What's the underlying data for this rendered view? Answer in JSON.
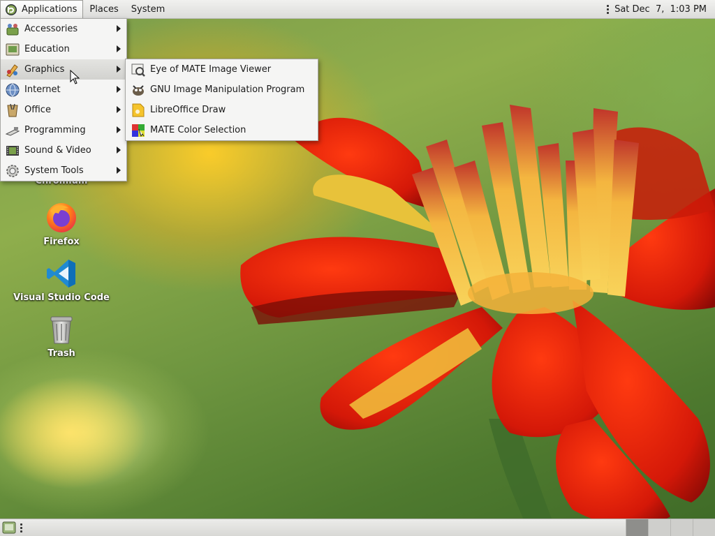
{
  "top_panel": {
    "applications_label": "Applications",
    "places_label": "Places",
    "system_label": "System",
    "clock": "Sat Dec  7,  1:03 PM"
  },
  "applications_menu": {
    "items": [
      {
        "label": "Accessories",
        "icon": "accessories-icon"
      },
      {
        "label": "Education",
        "icon": "education-icon"
      },
      {
        "label": "Graphics",
        "icon": "graphics-icon",
        "highlighted": true
      },
      {
        "label": "Internet",
        "icon": "internet-icon"
      },
      {
        "label": "Office",
        "icon": "office-icon"
      },
      {
        "label": "Programming",
        "icon": "programming-icon"
      },
      {
        "label": "Sound & Video",
        "icon": "sound-video-icon"
      },
      {
        "label": "System Tools",
        "icon": "system-tools-icon"
      }
    ]
  },
  "graphics_submenu": {
    "items": [
      {
        "label": "Eye of MATE Image Viewer",
        "icon": "image-viewer-icon"
      },
      {
        "label": "GNU Image Manipulation Program",
        "icon": "gimp-icon"
      },
      {
        "label": "LibreOffice Draw",
        "icon": "libreoffice-draw-icon"
      },
      {
        "label": "MATE Color Selection",
        "icon": "color-selection-icon"
      }
    ]
  },
  "desktop": {
    "icons": [
      {
        "label": "Chromium",
        "icon": "chromium-icon"
      },
      {
        "label": "Firefox",
        "icon": "firefox-icon"
      },
      {
        "label": "Visual Studio Code",
        "icon": "vscode-icon"
      },
      {
        "label": "Trash",
        "icon": "trash-icon"
      }
    ]
  },
  "bottom_panel": {
    "workspaces": 4,
    "active_workspace": 1
  },
  "colors": {
    "menu_bg": "#f5f5f4",
    "menu_highlight": "#d8d8d5",
    "panel_bg": "#e4e4e2"
  }
}
